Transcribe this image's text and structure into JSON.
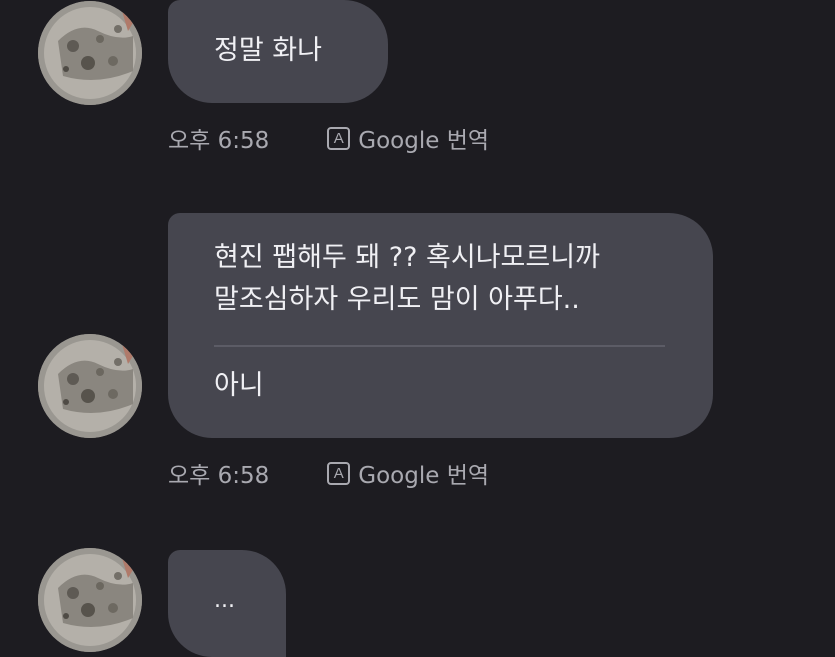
{
  "messages": [
    {
      "text": "정말 화나",
      "time": "오후 6:58",
      "translate_icon": "A",
      "translate_label": "Google 번역"
    },
    {
      "text": "현진 팹해두 돼 ?? 혹시나모르니까\n말조심하자 우리도 맘이 아푸다..",
      "reply": "아니",
      "time": "오후 6:58",
      "translate_icon": "A",
      "translate_label": "Google 번역"
    },
    {
      "text": "..."
    }
  ],
  "colors": {
    "background": "#1d1c21",
    "bubble": "#46464f",
    "meta_text": "#a9a9b0"
  }
}
